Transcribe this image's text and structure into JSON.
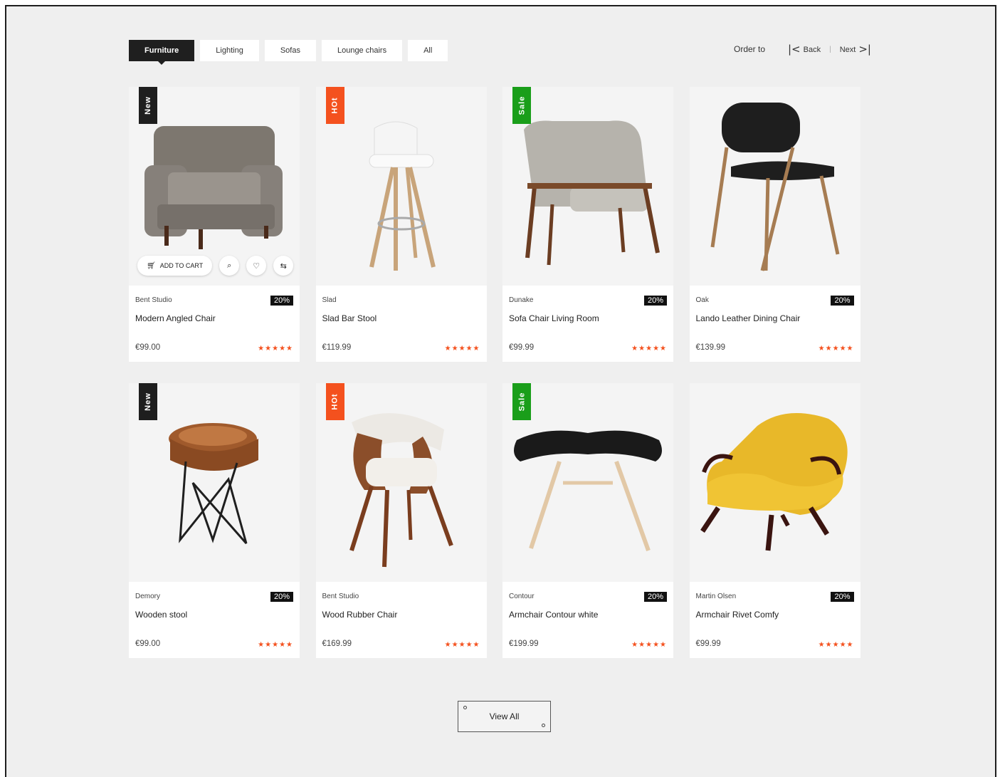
{
  "tabs": [
    {
      "label": "Furniture",
      "active": true
    },
    {
      "label": "Lighting",
      "active": false
    },
    {
      "label": "Sofas",
      "active": false
    },
    {
      "label": "Lounge chairs",
      "active": false
    },
    {
      "label": "All",
      "active": false
    }
  ],
  "order_label": "Order to",
  "pager": {
    "back": "Back",
    "next": "Next",
    "sep": "|",
    "back_icon": "first-page-icon",
    "next_icon": "last-page-icon"
  },
  "hover_actions": {
    "add_to_cart": "ADD TO CART",
    "cart_icon": "cart-icon",
    "search_icon": "search-icon",
    "wishlist_icon": "heart-icon",
    "compare_icon": "compare-icon"
  },
  "products": [
    {
      "badge": "New",
      "badge_color": "#1e1e1e",
      "brand": "Bent Studio",
      "discount": "20%",
      "name": "Modern Angled Chair",
      "price": "€99.00",
      "stars": "★★★★★",
      "image": "armchair-grey"
    },
    {
      "badge": "HOt",
      "badge_color": "#f4511e",
      "brand": "Slad",
      "discount": "",
      "name": "Slad Bar Stool",
      "price": "€119.99",
      "stars": "★★★★★",
      "image": "bar-stool"
    },
    {
      "badge": "Sale",
      "badge_color": "#1a9e1a",
      "brand": "Dunake",
      "discount": "20%",
      "name": "Sofa Chair Living Room",
      "price": "€99.99",
      "stars": "★★★★★",
      "image": "lounge-chair"
    },
    {
      "badge": "",
      "badge_color": "",
      "brand": "Oak",
      "discount": "20%",
      "name": "Lando Leather Dining Chair",
      "price": "€139.99",
      "stars": "★★★★★",
      "image": "dining-chair"
    },
    {
      "badge": "New",
      "badge_color": "#1e1e1e",
      "brand": "Demory",
      "discount": "20%",
      "name": "Wooden stool",
      "price": "€99.00",
      "stars": "★★★★★",
      "image": "wood-stool"
    },
    {
      "badge": "HOt",
      "badge_color": "#f4511e",
      "brand": "Bent Studio",
      "discount": "",
      "name": "Wood Rubber Chair",
      "price": "€169.99",
      "stars": "★★★★★",
      "image": "shell-chair"
    },
    {
      "badge": "Sale",
      "badge_color": "#1a9e1a",
      "brand": "Contour",
      "discount": "20%",
      "name": "Armchair Contour white",
      "price": "€199.99",
      "stars": "★★★★★",
      "image": "ottoman"
    },
    {
      "badge": "",
      "badge_color": "",
      "brand": "Martin Olsen",
      "discount": "20%",
      "name": "Armchair Rivet Comfy",
      "price": "€99.99",
      "stars": "★★★★★",
      "image": "yellow-armchair"
    }
  ],
  "view_all": "View All",
  "accent": "#f4511e"
}
